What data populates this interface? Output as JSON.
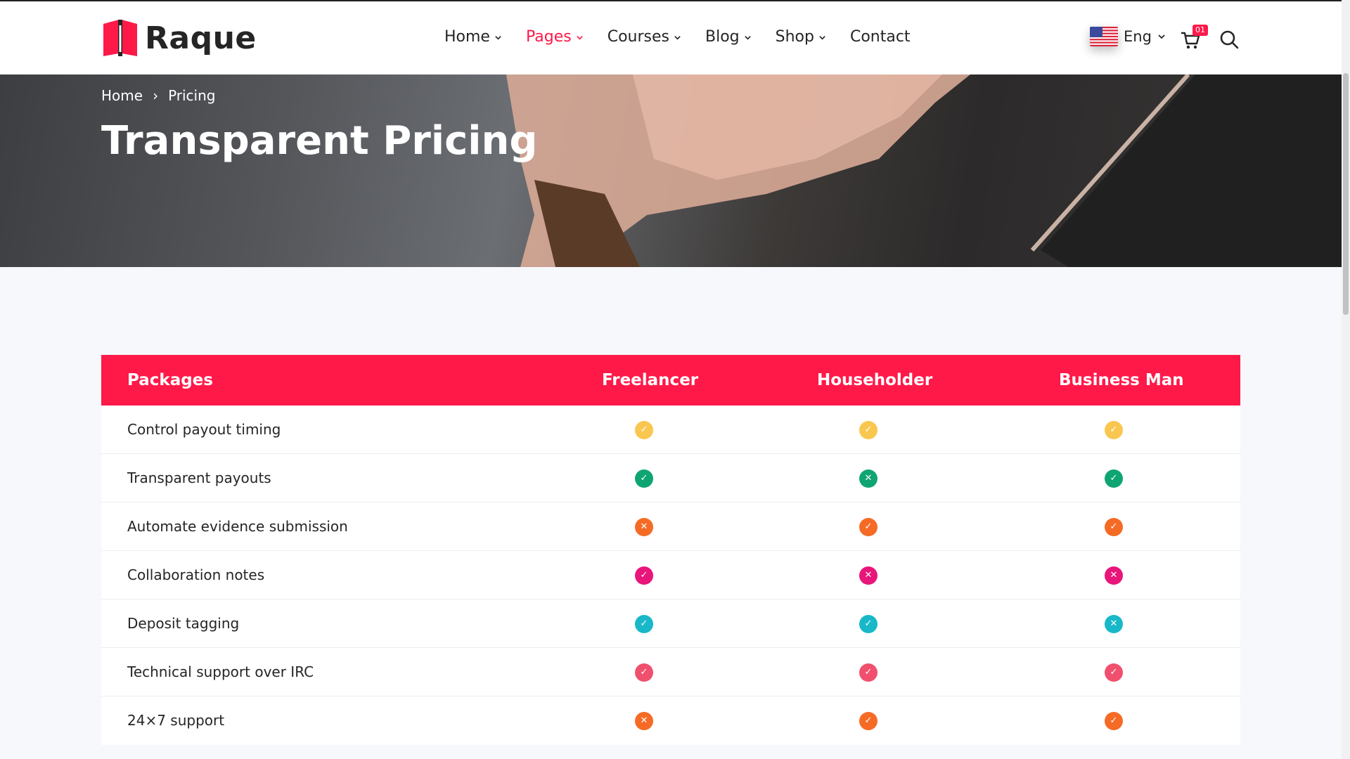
{
  "header": {
    "brand": "Raque",
    "nav": [
      {
        "label": "Home",
        "has_dropdown": true,
        "active": false
      },
      {
        "label": "Pages",
        "has_dropdown": true,
        "active": true
      },
      {
        "label": "Courses",
        "has_dropdown": true,
        "active": false
      },
      {
        "label": "Blog",
        "has_dropdown": true,
        "active": false
      },
      {
        "label": "Shop",
        "has_dropdown": true,
        "active": false
      },
      {
        "label": "Contact",
        "has_dropdown": false,
        "active": false
      }
    ],
    "language": "Eng",
    "cart_count": "01",
    "icons": [
      "us-flag-icon",
      "cart-icon",
      "search-icon"
    ]
  },
  "banner": {
    "breadcrumb": [
      "Home",
      "Pricing"
    ],
    "title": "Transparent Pricing"
  },
  "pricing_table": {
    "columns": [
      "Packages",
      "Freelancer",
      "Householder",
      "Business Man"
    ],
    "rows": [
      {
        "feature": "Control payout timing",
        "color": "#f9c74f",
        "marks": [
          "check",
          "check",
          "check"
        ]
      },
      {
        "feature": "Transparent payouts",
        "color": "#0fa573",
        "marks": [
          "check",
          "cross",
          "check"
        ]
      },
      {
        "feature": "Automate evidence submission",
        "color": "#f56b25",
        "marks": [
          "cross",
          "check",
          "check"
        ]
      },
      {
        "feature": "Collaboration notes",
        "color": "#e8157a",
        "marks": [
          "check",
          "cross",
          "cross"
        ]
      },
      {
        "feature": "Deposit tagging",
        "color": "#19b8c9",
        "marks": [
          "check",
          "check",
          "cross"
        ]
      },
      {
        "feature": "Technical support over IRC",
        "color": "#f0506e",
        "marks": [
          "check",
          "check",
          "check"
        ]
      },
      {
        "feature": "24×7 support",
        "color": "#f56b25",
        "marks": [
          "cross",
          "check",
          "check"
        ]
      }
    ]
  },
  "colors": {
    "accent": "#ff1949",
    "text": "#252525",
    "page_bg": "#f6f8fb"
  }
}
